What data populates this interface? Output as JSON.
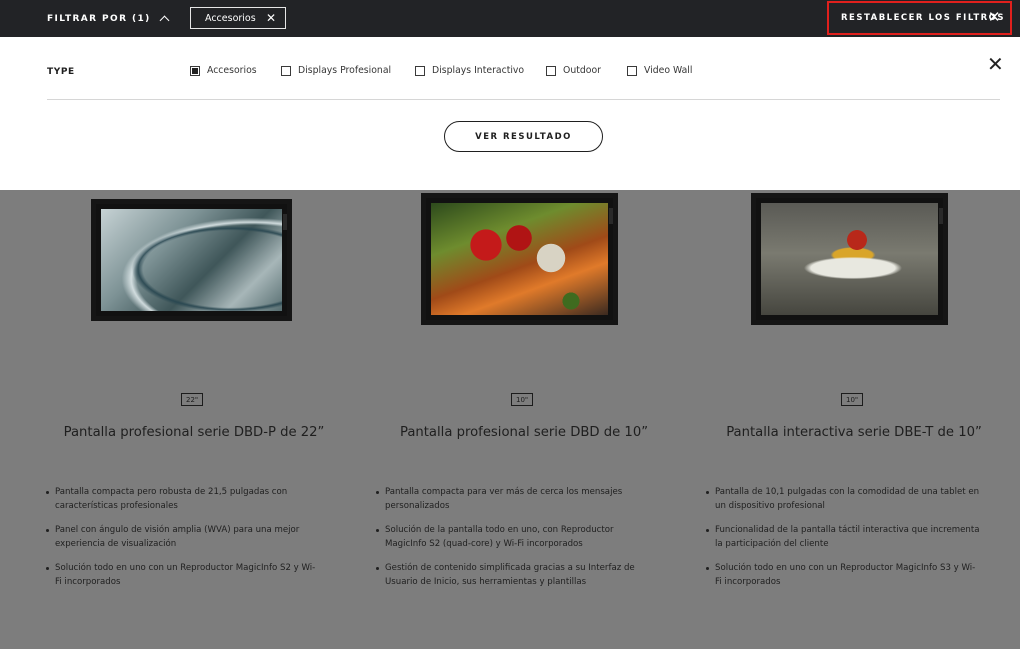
{
  "topbar": {
    "filter_label": "FILTRAR POR (1)",
    "active_chip": "Accesorios",
    "reset_label": "RESTABLECER LOS FILTROS",
    "reset_accent": "#e0201d"
  },
  "panel": {
    "type_label": "TYPE",
    "options": [
      {
        "label": "Accesorios",
        "checked": true
      },
      {
        "label": "Displays Profesional",
        "checked": false
      },
      {
        "label": "Displays Interactivo",
        "checked": false
      },
      {
        "label": "Outdoor",
        "checked": false
      },
      {
        "label": "Video Wall",
        "checked": false
      }
    ],
    "results_label": "VER RESULTADO"
  },
  "products": [
    {
      "size": "22\"",
      "title": "Pantalla profesional serie DBD-P de 22”",
      "features": [
        "Pantalla compacta pero robusta de 21,5 pulgadas con características profesionales",
        "Panel con ángulo de visión amplia (WVA) para una mejor experiencia de visualización",
        "Solución todo en uno con un Reproductor MagicInfo S2 y Wi-Fi incorporados"
      ]
    },
    {
      "size": "10\"",
      "title": "Pantalla profesional serie DBD de 10”",
      "features": [
        "Pantalla compacta para ver más de cerca los mensajes personalizados",
        "Solución de la pantalla todo en uno, con Reproductor MagicInfo S2 (quad-core) y Wi-Fi incorporados",
        "Gestión de contenido simplificada gracias a su Interfaz de Usuario de Inicio, sus herramientas y plantillas"
      ]
    },
    {
      "size": "10\"",
      "title": "Pantalla interactiva serie DBE-T de 10”",
      "features": [
        "Pantalla de 10,1 pulgadas con la comodidad de una tablet en un dispositivo profesional",
        "Funcionalidad de la pantalla táctil interactiva que incrementa la participación del cliente",
        "Solución todo en uno con un Reproductor MagicInfo S3 y Wi-Fi incorporados"
      ]
    }
  ],
  "icons": {
    "chevron": "chevron-up-icon",
    "close": "close-icon"
  }
}
